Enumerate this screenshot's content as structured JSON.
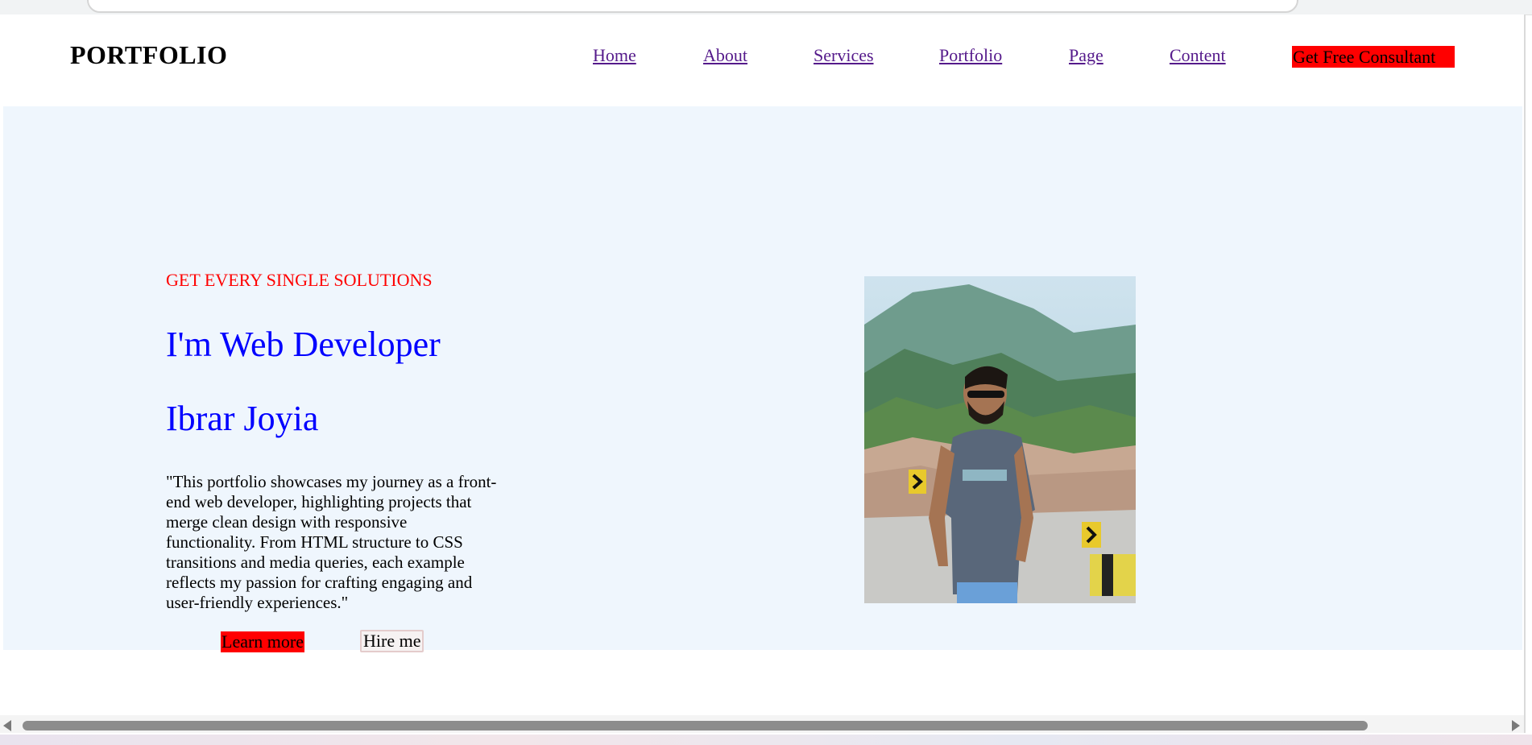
{
  "header": {
    "logo": "PORTFOLIO",
    "nav": [
      {
        "label": "Home"
      },
      {
        "label": "About"
      },
      {
        "label": "Services"
      },
      {
        "label": "Portfolio"
      },
      {
        "label": "Page"
      },
      {
        "label": "Content"
      }
    ],
    "cta_label": "Get Free Consultant"
  },
  "hero": {
    "tagline": "GET EVERY SINGLE SOLUTIONS",
    "headline": "I'm Web Developer",
    "name": "Ibrar Joyia",
    "bio": "\"This portfolio showcases my journey as a front-end web developer, highlighting projects that merge clean design with responsive functionality. From HTML structure to CSS transitions and media queries, each example reflects my passion for crafting engaging and user-friendly experiences.\"",
    "learn_more_label": "Learn more",
    "hire_me_label": "Hire me"
  },
  "colors": {
    "accent_red": "#ff0000",
    "heading_blue": "#0000ff",
    "link_visited": "#551a8b",
    "hero_bg": "#eff6fd"
  },
  "icons": {
    "scroll_left": "arrow-left-icon",
    "scroll_right": "arrow-right-icon"
  }
}
